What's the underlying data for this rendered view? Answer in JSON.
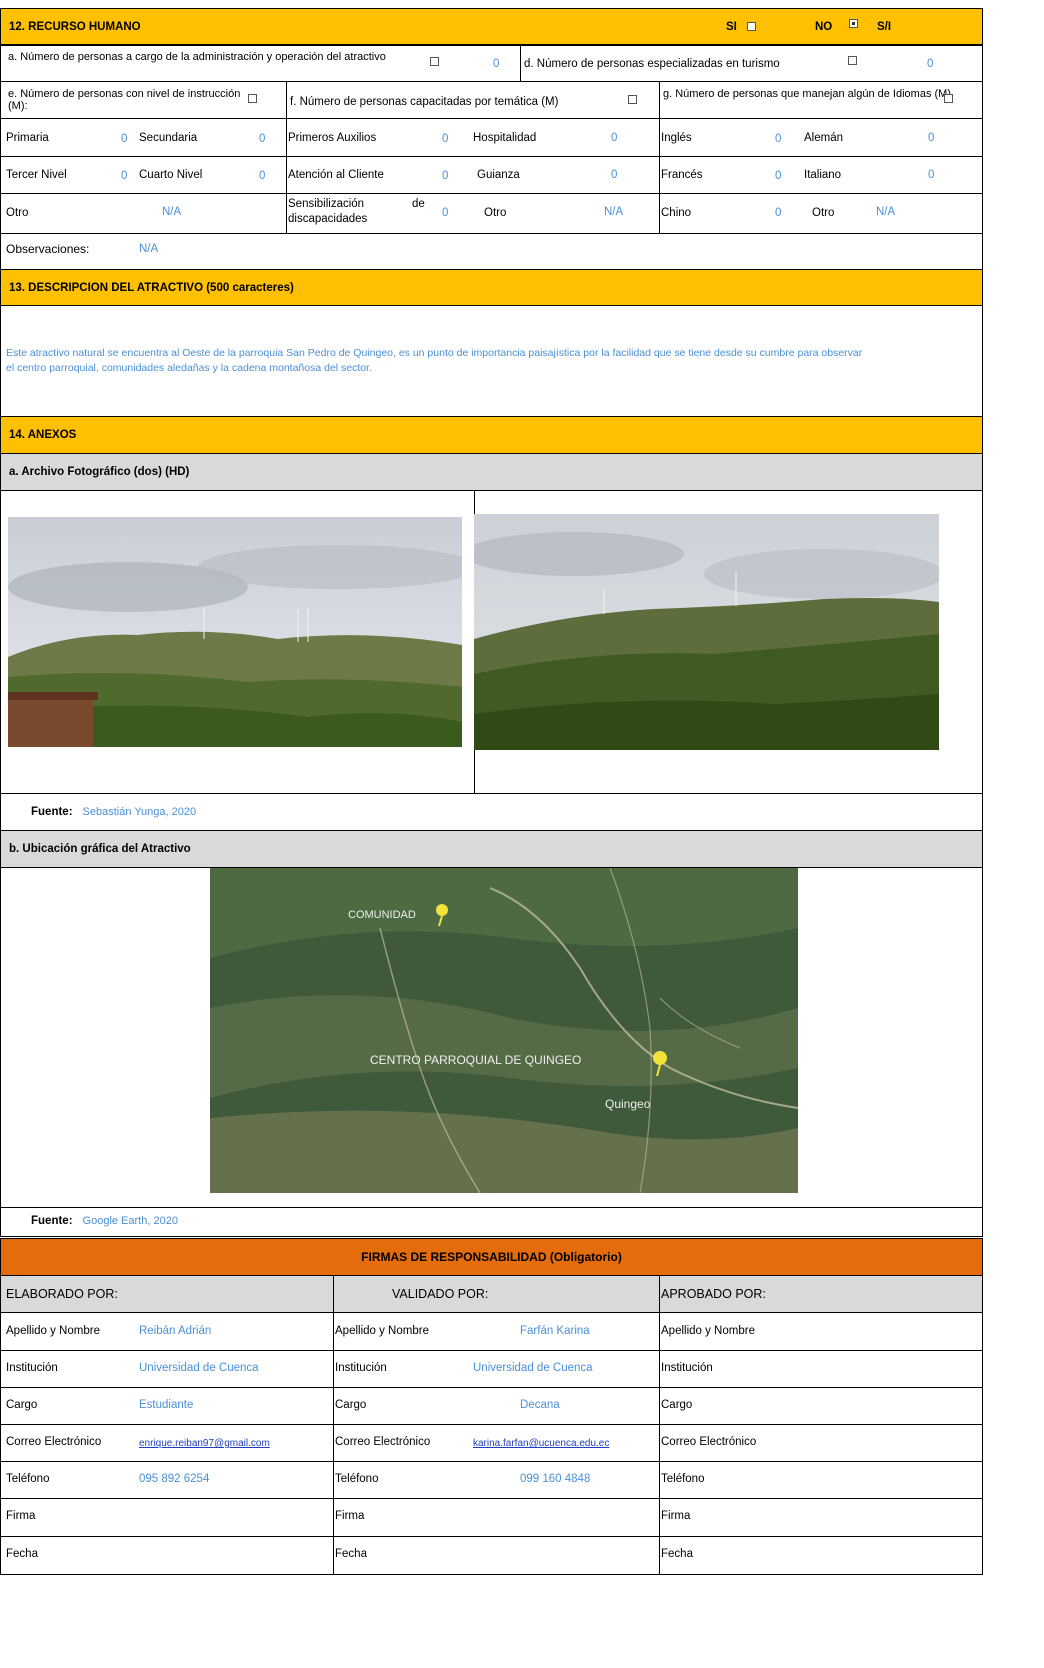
{
  "s12": {
    "title": "12. RECURSO HUMANO",
    "si": "SI",
    "no": "NO",
    "si_label": "S/I",
    "q_a": "a. Número de personas a cargo de la administración y operación del atractivo",
    "q_a_val": "0",
    "q_d": "d. Número de personas especializadas en turismo",
    "q_d_val": "0",
    "q_e": "e. Número de personas con nivel de instrucción (M):",
    "q_f": "f. Número de personas capacitadas por temática (M)",
    "q_g": "g. Número de personas que manejan algún de Idiomas (M)",
    "primaria": "Primaria",
    "primaria_val": "0",
    "secundaria": "Secundaria",
    "secundaria_val": "0",
    "tercer": "Tercer Nivel",
    "tercer_val": "0",
    "cuarto": "Cuarto Nivel",
    "cuarto_val": "0",
    "otro_e": "Otro",
    "otro_e_val": "N/A",
    "primeros": "Primeros Auxilios",
    "primeros_val": "0",
    "hospitalidad": "Hospitalidad",
    "hospitalidad_val": "0",
    "atencion": "Atención al Cliente",
    "atencion_val": "0",
    "guianza": "Guianza",
    "guianza_val": "0",
    "sensib_1": "Sensibilización",
    "sensib_de": "de",
    "sensib_2": "discapacidades",
    "sensib_val": "0",
    "otro_f": "Otro",
    "otro_f_val": "N/A",
    "ingles": "Inglés",
    "ingles_val": "0",
    "aleman": "Alemán",
    "aleman_val": "0",
    "frances": "Francés",
    "frances_val": "0",
    "italiano": "Italiano",
    "italiano_val": "0",
    "chino": "Chino",
    "chino_val": "0",
    "otro_g": "Otro",
    "otro_g_val": "N/A",
    "obs": "Observaciones:",
    "obs_val": "N/A"
  },
  "s13": {
    "title": "13. DESCRIPCION DEL ATRACTIVO (500 caracteres)",
    "text_1": "Este atractivo natural se encuentra al Oeste de la parroquia San Pedro de Quingeo, es un punto de importancia paisajística por la facilidad que se tiene desde su cumbre para observar",
    "text_2": "el centro parroquial, comunidades aledañas y la cadena montañosa del sector."
  },
  "s14": {
    "title": "14. ANEXOS",
    "a_title": "a. Archivo Fotográfico (dos) (HD)",
    "fuente_label": "Fuente:",
    "fuente_a": "Sebastián Yunga, 2020",
    "b_title": "b. Ubicación gráfica del Atractivo",
    "map_label_1": "COMUNIDAD",
    "map_label_2": "CENTRO PARROQUIAL DE QUINGEO",
    "map_label_3": "Quingeo",
    "fuente_b": "Google Earth, 2020"
  },
  "firmas": {
    "title": "FIRMAS DE RESPONSABILIDAD (Obligatorio)",
    "elaborado": "ELABORADO POR:",
    "validado": "VALIDADO POR:",
    "aprobado": "APROBADO POR:",
    "apellido": "Apellido y Nombre",
    "institucion": "Institución",
    "cargo": "Cargo",
    "correo": "Correo Electrónico",
    "telefono": "Teléfono",
    "firma": "Firma",
    "fecha": "Fecha",
    "c1": {
      "nombre": "Reibán Adrián",
      "inst": "Universidad de Cuenca",
      "cargo": "Estudiante",
      "correo": "enrique.reiban97@gmail.com",
      "tel": "095 892 6254"
    },
    "c2": {
      "nombre": "Farfán Karina",
      "inst": "Universidad de Cuenca",
      "cargo": "Decana",
      "correo": "karina.farfan@ucuenca.edu.ec",
      "tel": "099 160 4848"
    }
  }
}
